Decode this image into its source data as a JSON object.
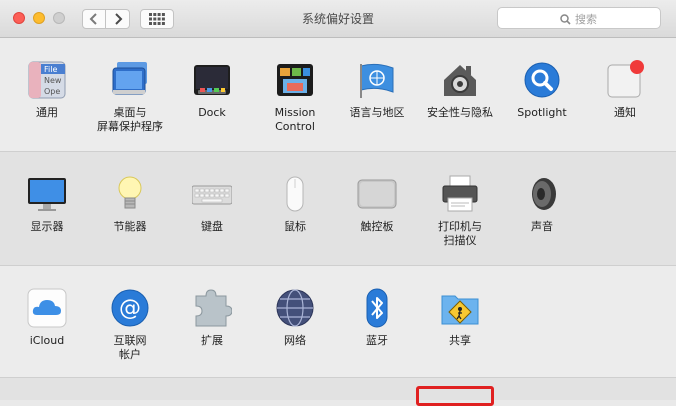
{
  "window": {
    "title": "系统偏好设置"
  },
  "search": {
    "placeholder": "搜索"
  },
  "row1": [
    {
      "name": "general",
      "label": "通用"
    },
    {
      "name": "desktop",
      "label": "桌面与\n屏幕保护程序"
    },
    {
      "name": "dock",
      "label": "Dock"
    },
    {
      "name": "mission-control",
      "label": "Mission\nControl"
    },
    {
      "name": "language",
      "label": "语言与地区"
    },
    {
      "name": "security",
      "label": "安全性与隐私"
    },
    {
      "name": "spotlight",
      "label": "Spotlight"
    },
    {
      "name": "notifications",
      "label": "通知"
    }
  ],
  "row2": [
    {
      "name": "displays",
      "label": "显示器"
    },
    {
      "name": "energy",
      "label": "节能器"
    },
    {
      "name": "keyboard",
      "label": "键盘"
    },
    {
      "name": "mouse",
      "label": "鼠标"
    },
    {
      "name": "trackpad",
      "label": "触控板"
    },
    {
      "name": "printers",
      "label": "打印机与\n扫描仪"
    },
    {
      "name": "sound",
      "label": "声音"
    }
  ],
  "row3": [
    {
      "name": "icloud",
      "label": "iCloud"
    },
    {
      "name": "internet-accounts",
      "label": "互联网\n帐户"
    },
    {
      "name": "extensions",
      "label": "扩展"
    },
    {
      "name": "network",
      "label": "网络"
    },
    {
      "name": "bluetooth",
      "label": "蓝牙"
    },
    {
      "name": "sharing",
      "label": "共享"
    }
  ],
  "general_icon_text": [
    "File",
    "New",
    "Ope"
  ],
  "colors": {
    "highlight": "#e02020",
    "accent": "#2a7bd8"
  }
}
